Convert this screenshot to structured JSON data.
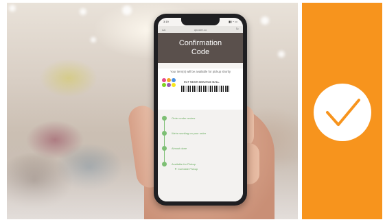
{
  "phone_screen": {
    "status_time": "3:19",
    "status_icons": "▮▮ ◔ ▭",
    "url_aa": "AA",
    "url": "qbuster.co",
    "reload_icon": "reload-icon",
    "title_line1": "Confirmation",
    "title_line2": "Code",
    "pickup_message": "Your item(s) will be available for pickup shortly",
    "item_name": "6CT NEON BOUNCE BALL",
    "timeline": [
      {
        "label": "Order under review"
      },
      {
        "label": "We're working on your order"
      },
      {
        "label": "Almost done"
      },
      {
        "label": "Available for Pickup"
      }
    ],
    "timeline_sub": "▼ Curbside Pickup"
  },
  "colors": {
    "orange_panel": "#f7941d",
    "header_brown": "#5a504c",
    "timeline_green": "#7dbf74",
    "swatch": [
      "#e84b8a",
      "#f5a623",
      "#4a90e2",
      "#7ed321",
      "#9b59b6",
      "#f8e71c"
    ]
  },
  "icons": {
    "checkmark": "checkmark-icon"
  }
}
